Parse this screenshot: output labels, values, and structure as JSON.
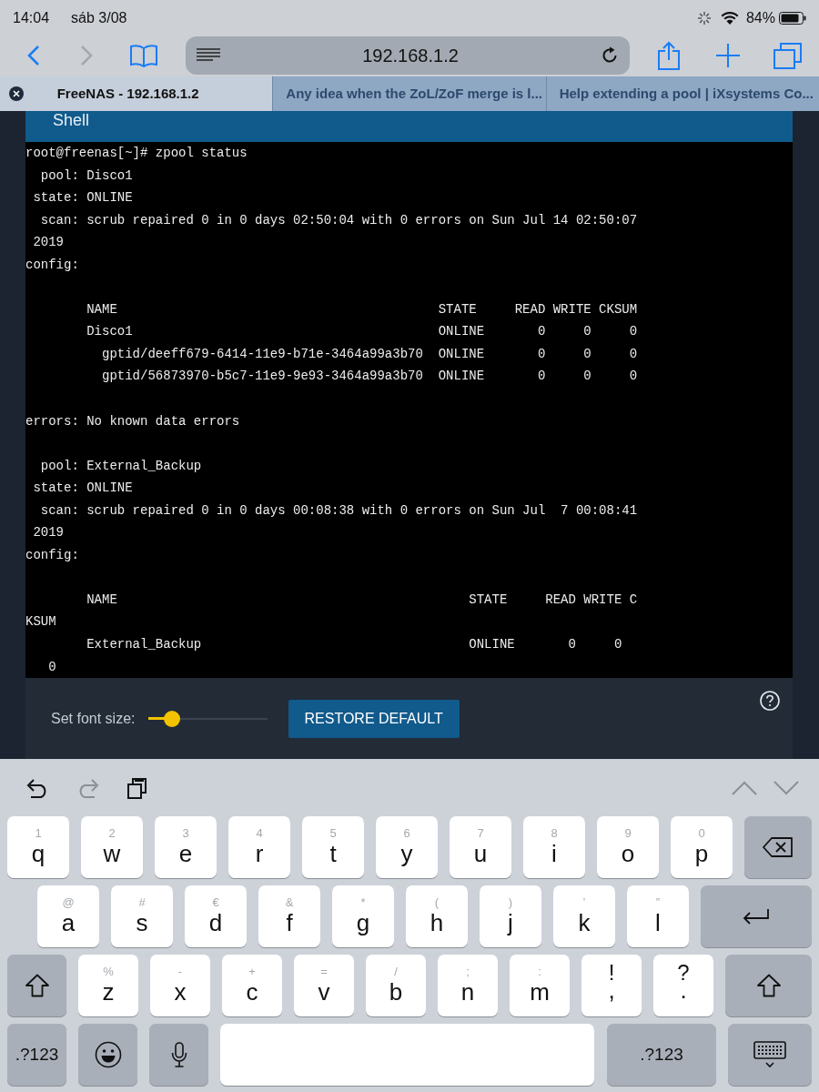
{
  "status_bar": {
    "time": "14:04",
    "date": "sáb 3/08",
    "battery": "84%"
  },
  "toolbar": {
    "back_disabled": false,
    "forward_disabled": true,
    "address": "192.168.1.2"
  },
  "tabs": [
    {
      "title": "FreeNAS - 192.168.1.2",
      "selected": true
    },
    {
      "title": "Any idea when the ZoL/ZoF merge is l...",
      "selected": false
    },
    {
      "title": "Help extending a pool | iXsystems Co...",
      "selected": false
    }
  ],
  "shell": {
    "title": "Shell",
    "lines": [
      {
        "text": "root@freenas[~]# zpool status"
      },
      {
        "text": "  pool: Disco1"
      },
      {
        "text": " state: ONLINE"
      },
      {
        "text": "  scan: scrub repaired 0 in 0 days 02:50:04 with 0 errors on Sun Jul 14 02:50:07"
      },
      {
        "text": " 2019"
      },
      {
        "text": "config:"
      },
      {
        "text": "        NAME                                          STATE     READ WRITE CKSUM",
        "blank_before": true
      },
      {
        "text": "        Disco1                                        ONLINE       0     0     0"
      },
      {
        "text": "          gptid/deeff679-6414-11e9-b71e-3464a99a3b70  ONLINE       0     0     0"
      },
      {
        "text": "          gptid/56873970-b5c7-11e9-9e93-3464a99a3b70  ONLINE       0     0     0"
      },
      {
        "text": "errors: No known data errors",
        "blank_before": true
      },
      {
        "text": "  pool: External_Backup",
        "blank_before": true
      },
      {
        "text": " state: ONLINE"
      },
      {
        "text": "  scan: scrub repaired 0 in 0 days 00:08:38 with 0 errors on Sun Jul  7 00:08:41"
      },
      {
        "text": " 2019"
      },
      {
        "text": "config:"
      },
      {
        "text": "        NAME                                              STATE     READ WRITE C",
        "blank_before": true
      },
      {
        "text": "KSUM"
      },
      {
        "text": "        External_Backup                                   ONLINE       0     0"
      },
      {
        "text": "   0"
      }
    ],
    "font_size_label": "Set font size:",
    "font_size": {
      "level": 0.2
    },
    "restore_button": "RESTORE DEFAULT"
  },
  "keyboard": {
    "redo_disabled": true,
    "rows": [
      [
        {
          "kind": "letter",
          "label": "q",
          "hint": "1"
        },
        {
          "kind": "letter",
          "label": "w",
          "hint": "2"
        },
        {
          "kind": "letter",
          "label": "e",
          "hint": "3"
        },
        {
          "kind": "letter",
          "label": "r",
          "hint": "4"
        },
        {
          "kind": "letter",
          "label": "t",
          "hint": "5"
        },
        {
          "kind": "letter",
          "label": "y",
          "hint": "6"
        },
        {
          "kind": "letter",
          "label": "u",
          "hint": "7"
        },
        {
          "kind": "letter",
          "label": "i",
          "hint": "8"
        },
        {
          "kind": "letter",
          "label": "o",
          "hint": "9"
        },
        {
          "kind": "letter",
          "label": "p",
          "hint": "0"
        },
        {
          "kind": "backspace"
        }
      ],
      [
        {
          "kind": "letter",
          "label": "a",
          "hint": "@"
        },
        {
          "kind": "letter",
          "label": "s",
          "hint": "#"
        },
        {
          "kind": "letter",
          "label": "d",
          "hint": "€"
        },
        {
          "kind": "letter",
          "label": "f",
          "hint": "&"
        },
        {
          "kind": "letter",
          "label": "g",
          "hint": "*"
        },
        {
          "kind": "letter",
          "label": "h",
          "hint": "("
        },
        {
          "kind": "letter",
          "label": "j",
          "hint": ")"
        },
        {
          "kind": "letter",
          "label": "k",
          "hint": "’"
        },
        {
          "kind": "letter",
          "label": "l",
          "hint": "”"
        },
        {
          "kind": "return"
        }
      ],
      [
        {
          "kind": "shift"
        },
        {
          "kind": "letter",
          "label": "z",
          "hint": "%"
        },
        {
          "kind": "letter",
          "label": "x",
          "hint": "-"
        },
        {
          "kind": "letter",
          "label": "c",
          "hint": "+"
        },
        {
          "kind": "letter",
          "label": "v",
          "hint": "="
        },
        {
          "kind": "letter",
          "label": "b",
          "hint": "/"
        },
        {
          "kind": "letter",
          "label": "n",
          "hint": ";"
        },
        {
          "kind": "letter",
          "label": "m",
          "hint": ":"
        },
        {
          "kind": "punct",
          "label": ",",
          "hint": "!"
        },
        {
          "kind": "punct",
          "label": ".",
          "hint": "?"
        },
        {
          "kind": "shift"
        }
      ],
      [
        {
          "kind": "symbols",
          "label": ".?123"
        },
        {
          "kind": "emoji"
        },
        {
          "kind": "mic"
        },
        {
          "kind": "space"
        },
        {
          "kind": "symbols",
          "label": ".?123",
          "wide": true
        },
        {
          "kind": "hide"
        }
      ]
    ]
  }
}
